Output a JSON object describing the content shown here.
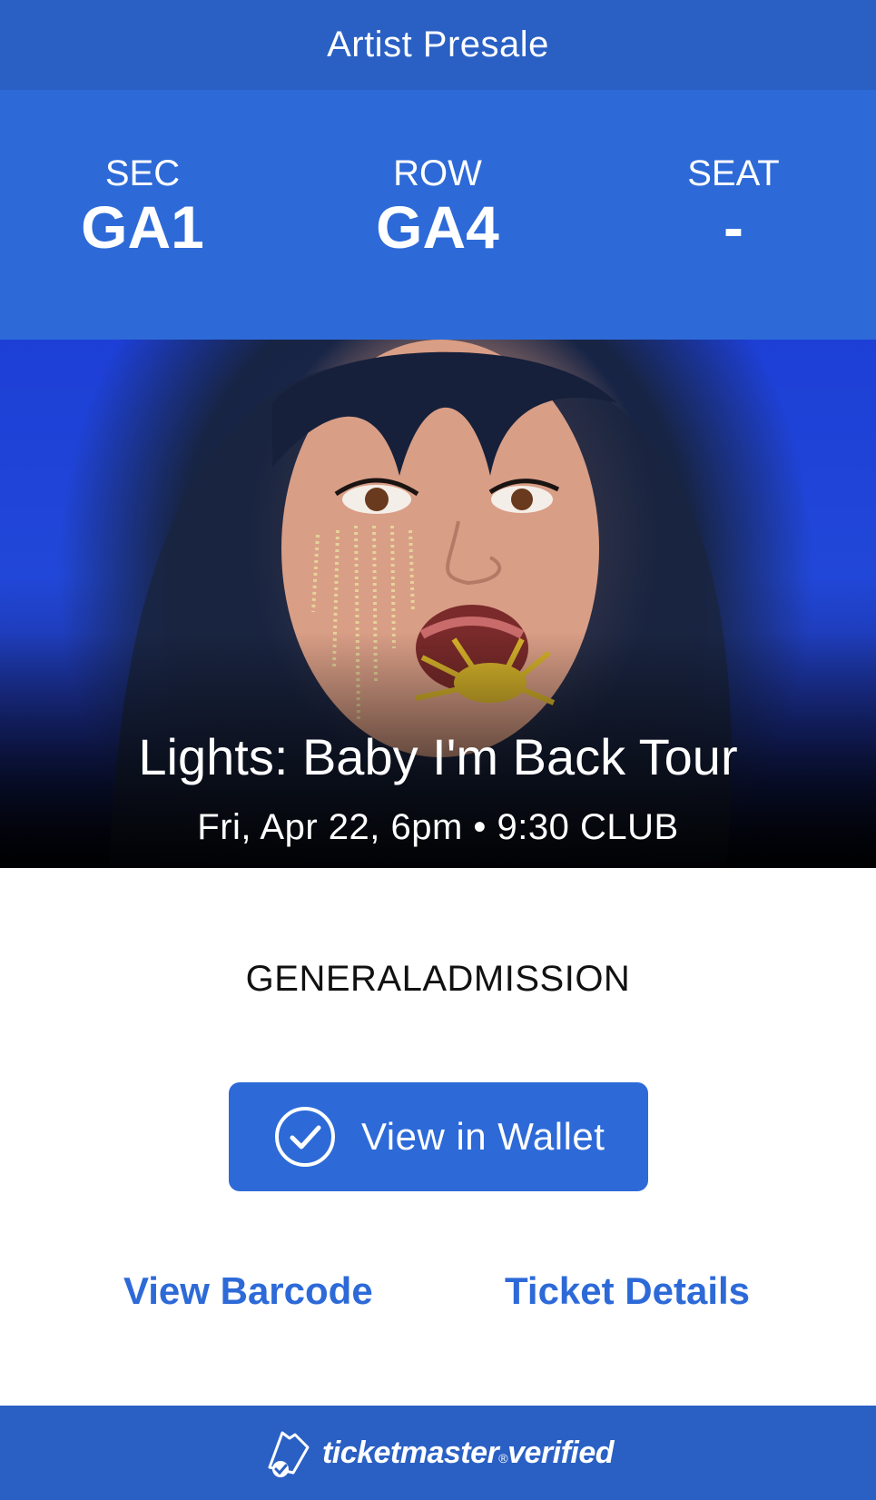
{
  "header": {
    "presale_label": "Artist Presale"
  },
  "seat": {
    "sec_label": "SEC",
    "sec_value": "GA1",
    "row_label": "ROW",
    "row_value": "GA4",
    "seat_label": "SEAT",
    "seat_value": "-"
  },
  "event": {
    "title": "Lights: Baby I'm Back Tour",
    "subtitle": "Fri, Apr 22, 6pm • 9:30 CLUB"
  },
  "admission": "GENERALADMISSION",
  "actions": {
    "wallet_label": "View in Wallet",
    "wallet_icon": "check-circle-icon",
    "barcode_label": "View Barcode",
    "details_label": "Ticket Details"
  },
  "footer": {
    "brand_name": "ticketmaster",
    "brand_reg": "®",
    "brand_suffix": "verified",
    "logo_icon": "ticket-check-icon"
  },
  "colors": {
    "header_blue": "#2a60c4",
    "panel_blue": "#2d6ad8",
    "link_blue": "#2d6ad8"
  }
}
